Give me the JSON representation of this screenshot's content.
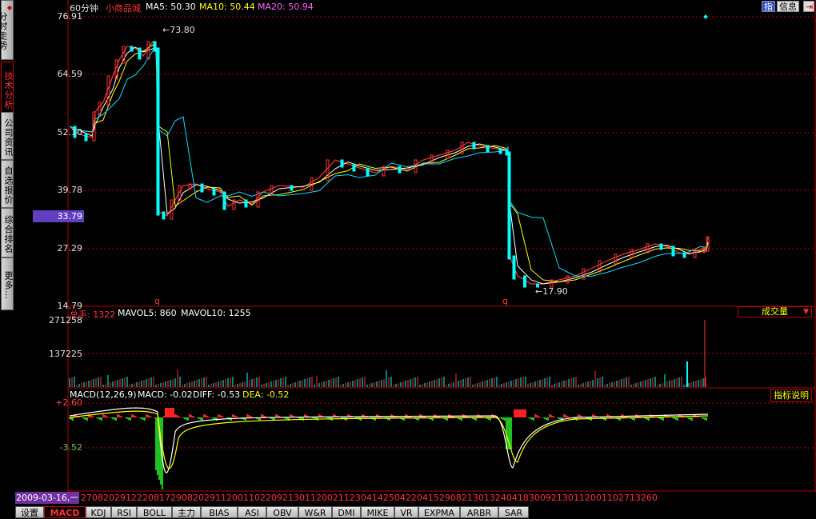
{
  "sidebar": {
    "tabs": [
      {
        "label": "分时走势",
        "active": false
      },
      {
        "label": "技术分析",
        "active": true
      },
      {
        "label": "公司资讯",
        "active": false
      },
      {
        "label": "自选报价",
        "active": false
      },
      {
        "label": "综合排名",
        "active": false
      },
      {
        "label": "更多…",
        "active": false
      }
    ]
  },
  "header": {
    "period": "60分钟",
    "stock_name": "小商品城",
    "ma5": "MA5: 50.30",
    "ma10": "MA10: 50.44",
    "ma20": "MA20: 50.94",
    "btn_index": "指",
    "btn_info": "信息"
  },
  "price_axis": {
    "ticks": [
      "76.91",
      "64.59",
      "52.10",
      "39.78",
      "27.29",
      "14.79"
    ],
    "highlight": "33.79",
    "high_label": "73.80",
    "low_label": "17.90"
  },
  "volume": {
    "header_total": "总手: 1322",
    "mavol5": "MAVOL5: 860",
    "mavol10": "MAVOL10: 1255",
    "ticks": [
      "271258",
      "137225"
    ],
    "selector": "成交量"
  },
  "macd": {
    "header_name": "MACD(12,26,9)",
    "macd_val": "MACD: -0.02",
    "diff": "DIFF: -0.53",
    "dea": "DEA: -0.52",
    "ticks": [
      "+2.60",
      "-3.52"
    ],
    "explain": "指标说明"
  },
  "date_row": {
    "cursor": "2009-03-16,一",
    "ticks": "2708202912220817290820291120011022092130112002112304142504220415290821301324041830092130112001102713260"
  },
  "bottom_tabs": [
    {
      "label": "设置",
      "active": false
    },
    {
      "label": "MACD",
      "active": true
    },
    {
      "label": "KDJ",
      "active": false
    },
    {
      "label": "RSI",
      "active": false
    },
    {
      "label": "BOLL",
      "active": false
    },
    {
      "label": "主力",
      "active": false
    },
    {
      "label": "BIAS",
      "active": false
    },
    {
      "label": "ASI",
      "active": false
    },
    {
      "label": "OBV",
      "active": false
    },
    {
      "label": "W&R",
      "active": false
    },
    {
      "label": "DMI",
      "active": false
    },
    {
      "label": "MIKE",
      "active": false
    },
    {
      "label": "VR",
      "active": false
    },
    {
      "label": "EXPMA",
      "active": false
    },
    {
      "label": "ARBR",
      "active": false
    },
    {
      "label": "SAR",
      "active": false
    }
  ],
  "colors": {
    "grid": "#b00000",
    "ma5": "#ffffff",
    "ma10": "#ffff00",
    "ma20": "#ff66ff",
    "up": "#ff3333",
    "down": "#00ffff",
    "macd_pos": "#ff2020",
    "macd_neg": "#20c020"
  }
}
